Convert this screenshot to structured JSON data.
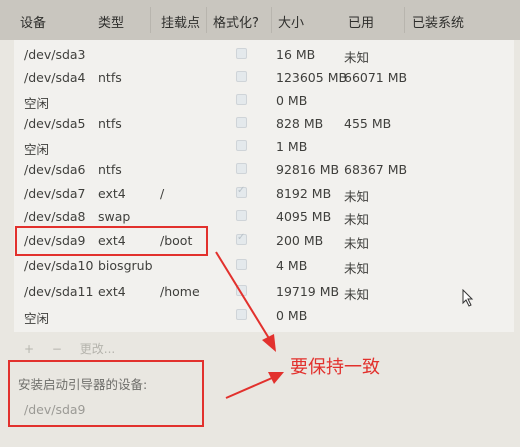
{
  "columns": [
    "设备",
    "类型",
    "挂载点",
    "格式化?",
    "大小",
    "已用",
    "已装系统"
  ],
  "rows": [
    {
      "device": "/dev/sda3",
      "type": "",
      "mount": "",
      "format": false,
      "size": "16 MB",
      "used": "未知"
    },
    {
      "device": "/dev/sda4",
      "type": "ntfs",
      "mount": "",
      "format": false,
      "size": "123605 MB",
      "used": "66071 MB"
    },
    {
      "device": "空闲",
      "type": "",
      "mount": "",
      "format": false,
      "size": "0 MB",
      "used": ""
    },
    {
      "device": "/dev/sda5",
      "type": "ntfs",
      "mount": "",
      "format": false,
      "size": "828 MB",
      "used": "455 MB"
    },
    {
      "device": "空闲",
      "type": "",
      "mount": "",
      "format": false,
      "size": "1 MB",
      "used": ""
    },
    {
      "device": "/dev/sda6",
      "type": "ntfs",
      "mount": "",
      "format": false,
      "size": "92816 MB",
      "used": "68367 MB"
    },
    {
      "device": "/dev/sda7",
      "type": "ext4",
      "mount": "/",
      "format": true,
      "size": "8192 MB",
      "used": "未知"
    },
    {
      "device": "/dev/sda8",
      "type": "swap",
      "mount": "",
      "format": false,
      "size": "4095 MB",
      "used": "未知"
    },
    {
      "device": "/dev/sda9",
      "type": "ext4",
      "mount": "/boot",
      "format": true,
      "size": "200 MB",
      "used": "未知"
    },
    {
      "device": "/dev/sda10",
      "type": "biosgrub",
      "mount": "",
      "format": false,
      "size": "4 MB",
      "used": "未知"
    },
    {
      "device": "/dev/sda11",
      "type": "ext4",
      "mount": "/home",
      "format": false,
      "size": "19719 MB",
      "used": "未知"
    },
    {
      "device": "空闲",
      "type": "",
      "mount": "",
      "format": false,
      "size": "0 MB",
      "used": ""
    }
  ],
  "toolbar": {
    "add": "+",
    "remove": "−",
    "change": "更改..."
  },
  "bootloader": {
    "label": "安装启动引导器的设备:",
    "value": "/dev/sda9"
  },
  "annotation": {
    "text": "要保持一致",
    "color": "#e2312d"
  }
}
